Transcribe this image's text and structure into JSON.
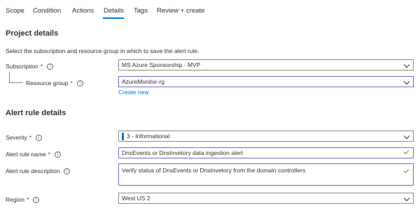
{
  "tabs": [
    {
      "label": "Scope"
    },
    {
      "label": "Condition"
    },
    {
      "label": "Actions"
    },
    {
      "label": "Details"
    },
    {
      "label": "Tags"
    },
    {
      "label": "Review + create"
    }
  ],
  "active_tab": "Details",
  "project": {
    "title": "Project details",
    "description": "Select the subscription and resource group in which to save the alert rule.",
    "subscription_label": "Subscription",
    "subscription_value": "MS Azure Sponsorship - MVP",
    "resource_group_label": "Resource group",
    "resource_group_value": "AzureMonitor-rg",
    "create_new": "Create new"
  },
  "alert": {
    "title": "Alert rule details",
    "severity_label": "Severity",
    "severity_value": "3 - Informational",
    "name_label": "Alert rule name",
    "name_value": "DnsEvents or DnsInvetory data ingestion alert",
    "desc_label": "Alert rule description",
    "desc_value": "Verify status of DnsEvents or DnsInvetory from the domain controllers",
    "region_label": "Region",
    "region_value": "West US 2"
  },
  "required_mark": "*",
  "info_glyph": "i",
  "colors": {
    "accent": "#0078d4",
    "focus_border": "#8661c5",
    "valid_check": "#57a300",
    "required": "#a4262c"
  }
}
